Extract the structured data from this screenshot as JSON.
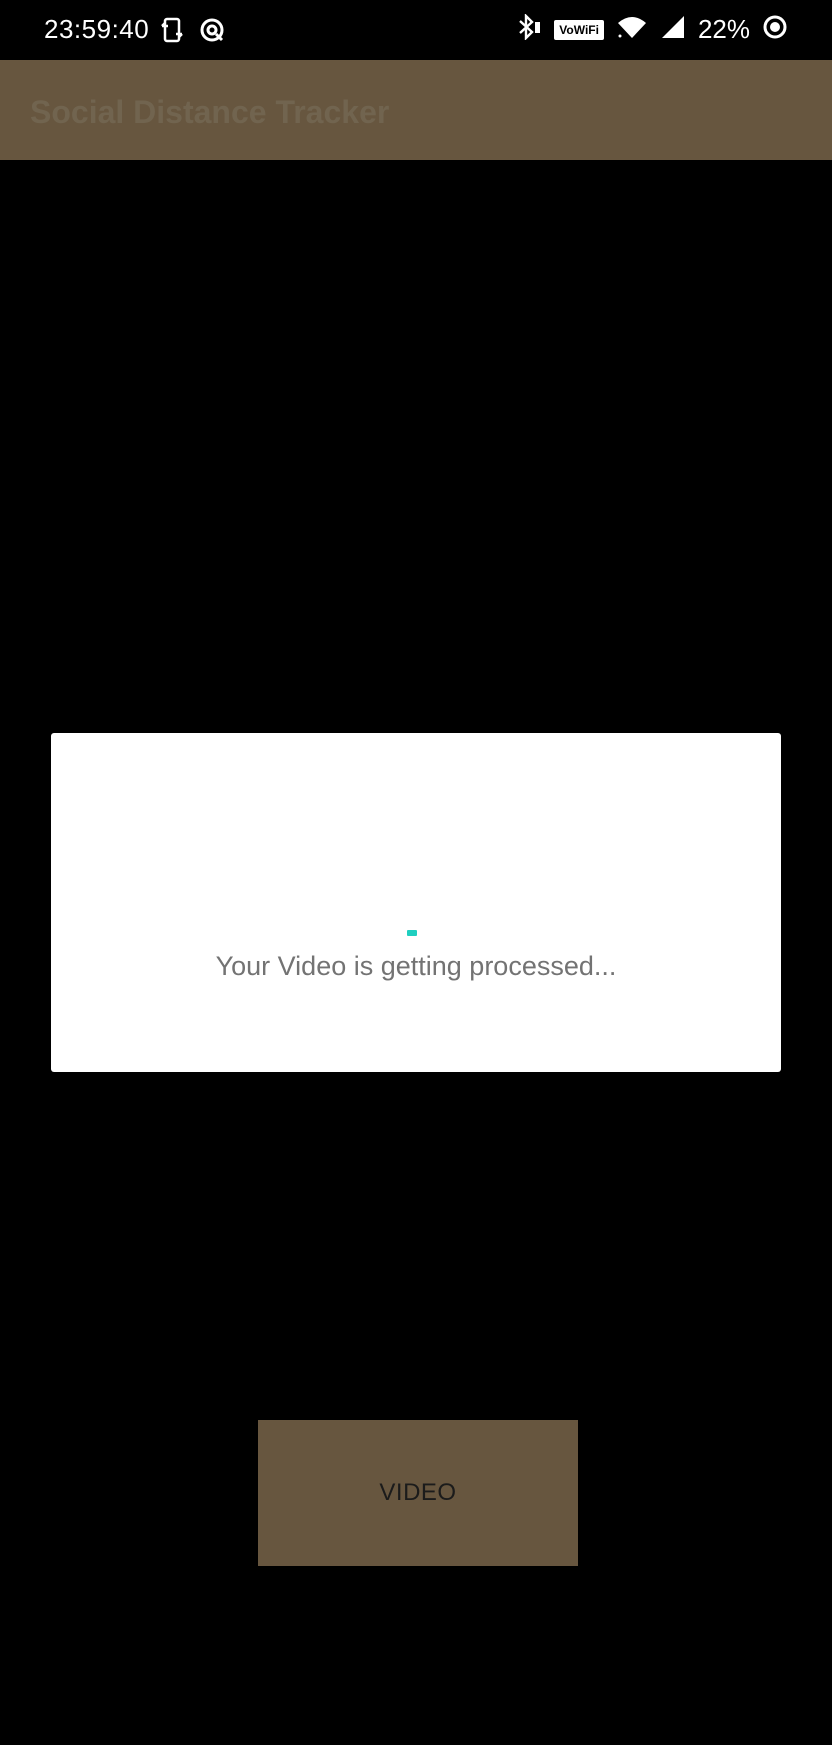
{
  "status_bar": {
    "time": "23:59:40",
    "vowifi_label": "VoWiFi",
    "battery": "22%",
    "icons": [
      "sync-icon",
      "data-saver-icon",
      "bluetooth-icon",
      "wifi-icon",
      "signal-icon",
      "battery-saver-icon"
    ]
  },
  "app_bar": {
    "title": "Social Distance Tracker",
    "color": "#67563f"
  },
  "dialog": {
    "message": "Your Video is getting processed...",
    "spinner_color": "#1fcfc0"
  },
  "main": {
    "video_button_label": "VIDEO"
  }
}
